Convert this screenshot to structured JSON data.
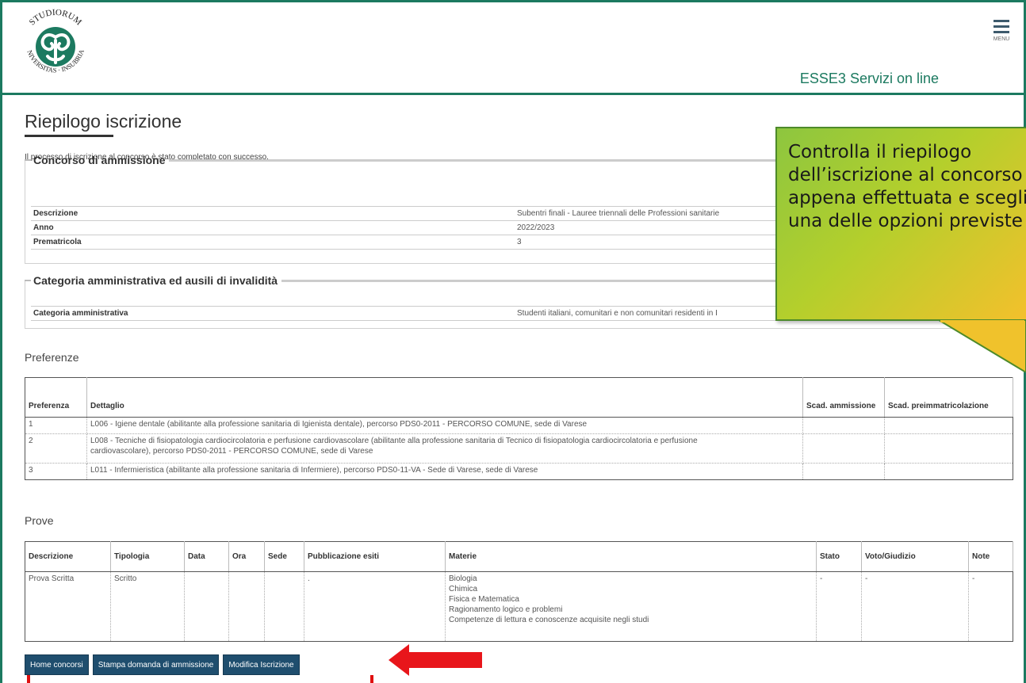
{
  "header": {
    "site_title": "ESSE3 Servizi on line",
    "menu_label": "MENU",
    "logo_text_top": "STUDIORUM",
    "logo_text_bottom": "UNIVERSITAS · INSUBRIAE",
    "brand_color": "#1c7a60"
  },
  "page": {
    "title": "Riepilogo iscrizione",
    "intro": "Il processo di iscrizione al concorso è stato completato con successo."
  },
  "concorso": {
    "legend": "Concorso di ammissione",
    "rows": [
      {
        "label": "Descrizione",
        "value": "Subentri finali - Lauree triennali delle Professioni sanitarie"
      },
      {
        "label": "Anno",
        "value": "2022/2023"
      },
      {
        "label": "Prematricola",
        "value": "3"
      }
    ]
  },
  "categoria": {
    "legend": "Categoria amministrativa ed ausili di invalidità",
    "rows": [
      {
        "label": "Categoria amministrativa",
        "value": "Studenti italiani, comunitari e non comunitari residenti in I"
      }
    ]
  },
  "preferenze": {
    "heading": "Preferenze",
    "headers": [
      "Preferenza",
      "Dettaglio",
      "Scad. ammissione",
      "Scad. preimmatricolazione"
    ],
    "rows": [
      {
        "num": "1",
        "detail": "L006 - Igiene dentale (abilitante alla professione sanitaria di Igienista dentale), percorso PDS0-2011 - PERCORSO COMUNE, sede di Varese"
      },
      {
        "num": "2",
        "detail": "L008 - Tecniche di fisiopatologia cardiocircolatoria e perfusione cardiovascolare (abilitante alla professione sanitaria di Tecnico di fisiopatologia cardiocircolatoria e perfusione cardiovascolare), percorso PDS0-2011 - PERCORSO COMUNE, sede di Varese"
      },
      {
        "num": "3",
        "detail": "L011 - Infermieristica (abilitante alla professione sanitaria di Infermiere), percorso PDS0-11-VA - Sede di Varese, sede di Varese"
      }
    ]
  },
  "prove": {
    "heading": "Prove",
    "headers": [
      "Descrizione",
      "Tipologia",
      "Data",
      "Ora",
      "Sede",
      "Pubblicazione esiti",
      "Materie",
      "Stato",
      "Voto/Giudizio",
      "Note"
    ],
    "row": {
      "descrizione": "Prova Scritta",
      "tipologia": "Scritto",
      "data": "",
      "ora": "",
      "sede": "",
      "pubblicazione": ".",
      "materie": [
        "Biologia",
        "Chimica",
        "Fisica e Matematica",
        "Ragionamento logico e problemi",
        "Competenze di lettura e conoscenze acquisite negli studi"
      ],
      "stato": "-",
      "voto": "-",
      "note": "-"
    }
  },
  "buttons": {
    "home": "Home concorsi",
    "stampa": "Stampa domanda di ammissione",
    "modifica": "Modifica Iscrizione"
  },
  "callout": {
    "text": "Controlla il riepilogo dell’iscrizione al concorso appena effettuata e scegli una delle opzioni previste"
  }
}
